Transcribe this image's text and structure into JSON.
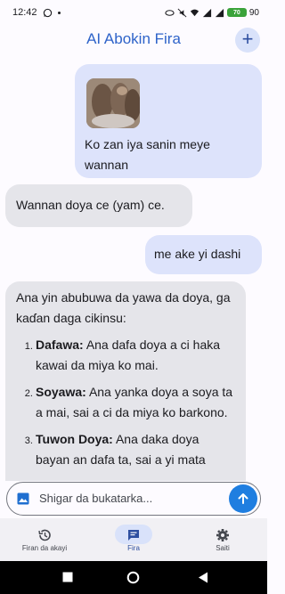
{
  "status": {
    "time": "12:42",
    "battery_level": "70",
    "battery_percent": "90"
  },
  "header": {
    "title": "AI Abokin Fira",
    "add_label": "+"
  },
  "messages": {
    "user_image_caption": "Ko zan iya sanin meye wannan",
    "bot_reply_1": "Wannan doya ce (yam) ce.",
    "user_text_1": "me ake yi dashi",
    "bot_reply_2": {
      "intro": "Ana yin abubuwa da yawa da doya, ga kaɗan daga cikinsu:",
      "items": [
        {
          "num": "1.",
          "title": "Dafawa:",
          "text": "Ana dafa doya a ci haka kawai da miya ko mai."
        },
        {
          "num": "2.",
          "title": "Soyawa:",
          "text": "Ana yanka doya a soya ta a mai, sai a ci da miya ko barkono."
        },
        {
          "num": "3.",
          "title": "Tuwon Doya:",
          "text": "Ana daka doya bayan an dafa ta, sai a yi mata"
        }
      ]
    }
  },
  "input": {
    "placeholder": "Shigar da bukatarka..."
  },
  "nav": {
    "history_label": "Firan da akayi",
    "chat_label": "Fira",
    "settings_label": "Saiti"
  }
}
